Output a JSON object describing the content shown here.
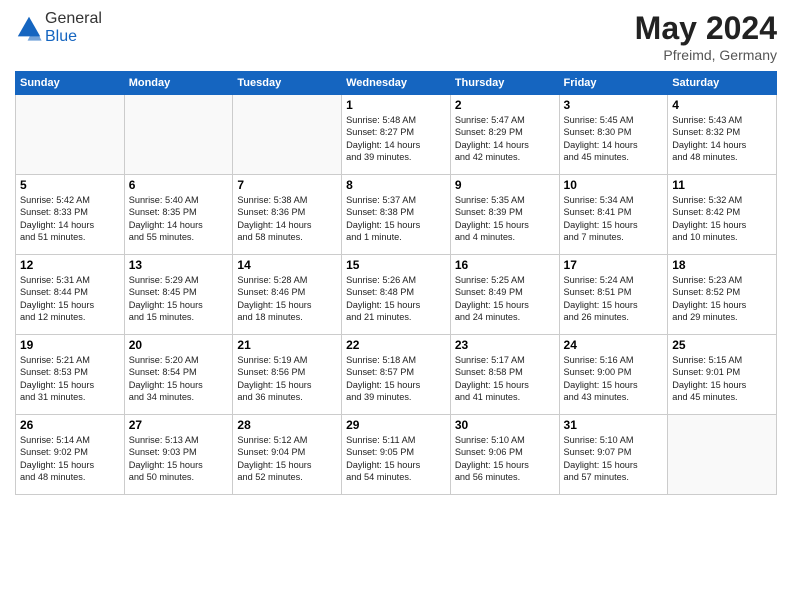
{
  "header": {
    "logo_general": "General",
    "logo_blue": "Blue",
    "month_year": "May 2024",
    "location": "Pfreimd, Germany"
  },
  "days_of_week": [
    "Sunday",
    "Monday",
    "Tuesday",
    "Wednesday",
    "Thursday",
    "Friday",
    "Saturday"
  ],
  "weeks": [
    [
      {
        "day": "",
        "info": ""
      },
      {
        "day": "",
        "info": ""
      },
      {
        "day": "",
        "info": ""
      },
      {
        "day": "1",
        "info": "Sunrise: 5:48 AM\nSunset: 8:27 PM\nDaylight: 14 hours\nand 39 minutes."
      },
      {
        "day": "2",
        "info": "Sunrise: 5:47 AM\nSunset: 8:29 PM\nDaylight: 14 hours\nand 42 minutes."
      },
      {
        "day": "3",
        "info": "Sunrise: 5:45 AM\nSunset: 8:30 PM\nDaylight: 14 hours\nand 45 minutes."
      },
      {
        "day": "4",
        "info": "Sunrise: 5:43 AM\nSunset: 8:32 PM\nDaylight: 14 hours\nand 48 minutes."
      }
    ],
    [
      {
        "day": "5",
        "info": "Sunrise: 5:42 AM\nSunset: 8:33 PM\nDaylight: 14 hours\nand 51 minutes."
      },
      {
        "day": "6",
        "info": "Sunrise: 5:40 AM\nSunset: 8:35 PM\nDaylight: 14 hours\nand 55 minutes."
      },
      {
        "day": "7",
        "info": "Sunrise: 5:38 AM\nSunset: 8:36 PM\nDaylight: 14 hours\nand 58 minutes."
      },
      {
        "day": "8",
        "info": "Sunrise: 5:37 AM\nSunset: 8:38 PM\nDaylight: 15 hours\nand 1 minute."
      },
      {
        "day": "9",
        "info": "Sunrise: 5:35 AM\nSunset: 8:39 PM\nDaylight: 15 hours\nand 4 minutes."
      },
      {
        "day": "10",
        "info": "Sunrise: 5:34 AM\nSunset: 8:41 PM\nDaylight: 15 hours\nand 7 minutes."
      },
      {
        "day": "11",
        "info": "Sunrise: 5:32 AM\nSunset: 8:42 PM\nDaylight: 15 hours\nand 10 minutes."
      }
    ],
    [
      {
        "day": "12",
        "info": "Sunrise: 5:31 AM\nSunset: 8:44 PM\nDaylight: 15 hours\nand 12 minutes."
      },
      {
        "day": "13",
        "info": "Sunrise: 5:29 AM\nSunset: 8:45 PM\nDaylight: 15 hours\nand 15 minutes."
      },
      {
        "day": "14",
        "info": "Sunrise: 5:28 AM\nSunset: 8:46 PM\nDaylight: 15 hours\nand 18 minutes."
      },
      {
        "day": "15",
        "info": "Sunrise: 5:26 AM\nSunset: 8:48 PM\nDaylight: 15 hours\nand 21 minutes."
      },
      {
        "day": "16",
        "info": "Sunrise: 5:25 AM\nSunset: 8:49 PM\nDaylight: 15 hours\nand 24 minutes."
      },
      {
        "day": "17",
        "info": "Sunrise: 5:24 AM\nSunset: 8:51 PM\nDaylight: 15 hours\nand 26 minutes."
      },
      {
        "day": "18",
        "info": "Sunrise: 5:23 AM\nSunset: 8:52 PM\nDaylight: 15 hours\nand 29 minutes."
      }
    ],
    [
      {
        "day": "19",
        "info": "Sunrise: 5:21 AM\nSunset: 8:53 PM\nDaylight: 15 hours\nand 31 minutes."
      },
      {
        "day": "20",
        "info": "Sunrise: 5:20 AM\nSunset: 8:54 PM\nDaylight: 15 hours\nand 34 minutes."
      },
      {
        "day": "21",
        "info": "Sunrise: 5:19 AM\nSunset: 8:56 PM\nDaylight: 15 hours\nand 36 minutes."
      },
      {
        "day": "22",
        "info": "Sunrise: 5:18 AM\nSunset: 8:57 PM\nDaylight: 15 hours\nand 39 minutes."
      },
      {
        "day": "23",
        "info": "Sunrise: 5:17 AM\nSunset: 8:58 PM\nDaylight: 15 hours\nand 41 minutes."
      },
      {
        "day": "24",
        "info": "Sunrise: 5:16 AM\nSunset: 9:00 PM\nDaylight: 15 hours\nand 43 minutes."
      },
      {
        "day": "25",
        "info": "Sunrise: 5:15 AM\nSunset: 9:01 PM\nDaylight: 15 hours\nand 45 minutes."
      }
    ],
    [
      {
        "day": "26",
        "info": "Sunrise: 5:14 AM\nSunset: 9:02 PM\nDaylight: 15 hours\nand 48 minutes."
      },
      {
        "day": "27",
        "info": "Sunrise: 5:13 AM\nSunset: 9:03 PM\nDaylight: 15 hours\nand 50 minutes."
      },
      {
        "day": "28",
        "info": "Sunrise: 5:12 AM\nSunset: 9:04 PM\nDaylight: 15 hours\nand 52 minutes."
      },
      {
        "day": "29",
        "info": "Sunrise: 5:11 AM\nSunset: 9:05 PM\nDaylight: 15 hours\nand 54 minutes."
      },
      {
        "day": "30",
        "info": "Sunrise: 5:10 AM\nSunset: 9:06 PM\nDaylight: 15 hours\nand 56 minutes."
      },
      {
        "day": "31",
        "info": "Sunrise: 5:10 AM\nSunset: 9:07 PM\nDaylight: 15 hours\nand 57 minutes."
      },
      {
        "day": "",
        "info": ""
      }
    ]
  ]
}
